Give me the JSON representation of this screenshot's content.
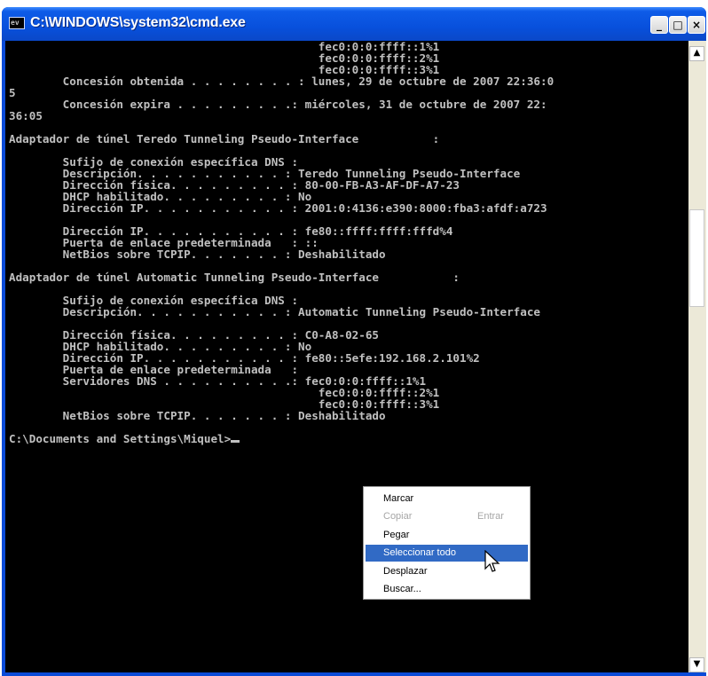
{
  "window": {
    "title": "C:\\WINDOWS\\system32\\cmd.exe",
    "icon_text": "ev",
    "buttons": {
      "minimize": "_",
      "maximize": "□",
      "close": "×"
    }
  },
  "console": {
    "lines": [
      "                                              fec0:0:0:ffff::1%1",
      "                                              fec0:0:0:ffff::2%1",
      "                                              fec0:0:0:ffff::3%1",
      "        Concesión obtenida . . . . . . . . : lunes, 29 de octubre de 2007 22:36:0",
      "5",
      "        Concesión expira . . . . . . . . .: miércoles, 31 de octubre de 2007 22:",
      "36:05",
      "",
      "Adaptador de túnel Teredo Tunneling Pseudo-Interface           :",
      "",
      "        Sufijo de conexión específica DNS :",
      "        Descripción. . . . . . . . . . . : Teredo Tunneling Pseudo-Interface",
      "        Dirección física. . . . . . . . . : 80-00-FB-A3-AF-DF-A7-23",
      "        DHCP habilitado. . . . . . . . . : No",
      "        Dirección IP. . . . . . . . . . . : 2001:0:4136:e390:8000:fba3:afdf:a723",
      "",
      "        Dirección IP. . . . . . . . . . . : fe80::ffff:ffff:fffd%4",
      "        Puerta de enlace predeterminada   : ::",
      "        NetBios sobre TCPIP. . . . . . . : Deshabilitado",
      "",
      "Adaptador de túnel Automatic Tunneling Pseudo-Interface           :",
      "",
      "        Sufijo de conexión específica DNS :",
      "        Descripción. . . . . . . . . . . : Automatic Tunneling Pseudo-Interface",
      "",
      "        Dirección física. . . . . . . . . : C0-A8-02-65",
      "        DHCP habilitado. . . . . . . . . : No",
      "        Dirección IP. . . . . . . . . . . : fe80::5efe:192.168.2.101%2",
      "        Puerta de enlace predeterminada   :",
      "        Servidores DNS . . . . . . . . . .: fec0:0:0:ffff::1%1",
      "                                              fec0:0:0:ffff::2%1",
      "                                              fec0:0:0:ffff::3%1",
      "        NetBios sobre TCPIP. . . . . . . : Deshabilitado",
      ""
    ],
    "prompt": "C:\\Documents and Settings\\Miquel>"
  },
  "scrollbar": {
    "up_arrow": "▲",
    "down_arrow": "▼"
  },
  "context_menu": {
    "items": [
      {
        "label": "Marcar",
        "shortcut": ""
      },
      {
        "label": "Copiar",
        "shortcut": "Entrar"
      },
      {
        "label": "Pegar",
        "shortcut": ""
      },
      {
        "label": "Seleccionar todo",
        "shortcut": ""
      },
      {
        "label": "Desplazar",
        "shortcut": ""
      },
      {
        "label": "Buscar...",
        "shortcut": ""
      }
    ]
  },
  "colors": {
    "titlebar": "#0a52dc",
    "console_bg": "#000000",
    "console_text": "#c0c0c0",
    "menu_highlight": "#316ac5",
    "menu_disabled": "#a6a6a6"
  }
}
